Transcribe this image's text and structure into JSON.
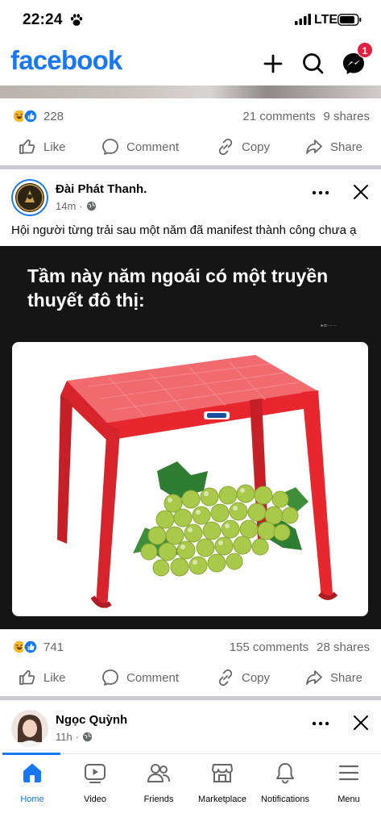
{
  "status_bar": {
    "time": "22:24",
    "network": "LTE"
  },
  "header": {
    "logo": "facebook",
    "messenger_badge": "1"
  },
  "prev_post": {
    "reaction_count": "228",
    "comments": "21 comments",
    "shares": "9 shares"
  },
  "actions": {
    "like": "Like",
    "comment": "Comment",
    "copy": "Copy",
    "share": "Share"
  },
  "post": {
    "page_name": "Đài Phát Thanh.",
    "time": "14m",
    "caption": "Hội người từng trải sau một năm đã manifest thành công chưa ạ",
    "meme_text": "Tầm này năm ngoái có một truyền thuyết đô thị:",
    "reaction_count": "741",
    "comments": "155 comments",
    "shares": "28 shares"
  },
  "next_post": {
    "name": "Ngọc Quỳnh",
    "time": "11h"
  },
  "nav": {
    "home": "Home",
    "video": "Video",
    "friends": "Friends",
    "marketplace": "Marketplace",
    "notifications": "Notifications",
    "menu": "Menu"
  },
  "colors": {
    "brand": "#1877f2",
    "badge": "#e41e3f",
    "table": "#e8262d",
    "grape": "#a9c94a"
  }
}
